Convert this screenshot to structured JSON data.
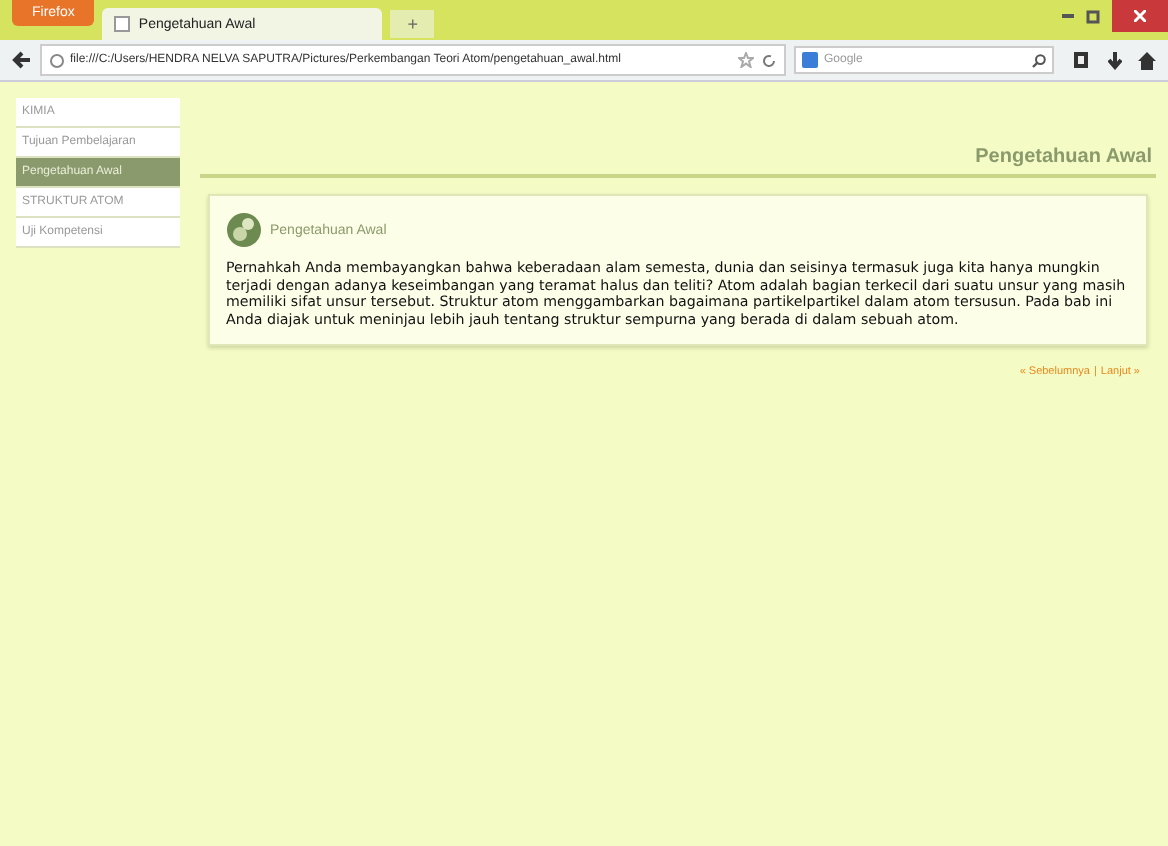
{
  "browser": {
    "menu_button": "Firefox",
    "tab_title": "Pengetahuan Awal",
    "new_tab": "+",
    "url": "file:///C:/Users/HENDRA NELVA SAPUTRA/Pictures/Perkembangan Teori Atom/pengetahuan_awal.html",
    "search_placeholder": "Google"
  },
  "sidebar": {
    "heading": "KIMIA",
    "items": [
      {
        "label": "Tujuan Pembelajaran",
        "selected": false
      },
      {
        "label": "Pengetahuan Awal",
        "selected": true
      },
      {
        "label": "STRUKTUR ATOM",
        "selected": false
      },
      {
        "label": "Uji Kompetensi",
        "selected": false
      }
    ]
  },
  "page_title": "Pengetahuan Awal",
  "card": {
    "title": "Pengetahuan Awal",
    "text": "Pernahkah Anda membayangkan bahwa keberadaan alam semesta, dunia dan seisinya termasuk juga kita hanya mungkin terjadi dengan adanya keseimbangan yang teramat halus dan teliti? Atom adalah bagian terkecil dari suatu unsur yang masih memiliki sifat unsur tersebut. Struktur atom menggambarkan bagaimana partikelpartikel dalam atom tersusun. Pada bab ini Anda diajak untuk meninjau lebih jauh tentang struktur sempurna yang berada di dalam sebuah atom."
  },
  "pager": {
    "previous": "« Sebelumnya",
    "separator": "|",
    "next": "Lanjut »"
  }
}
